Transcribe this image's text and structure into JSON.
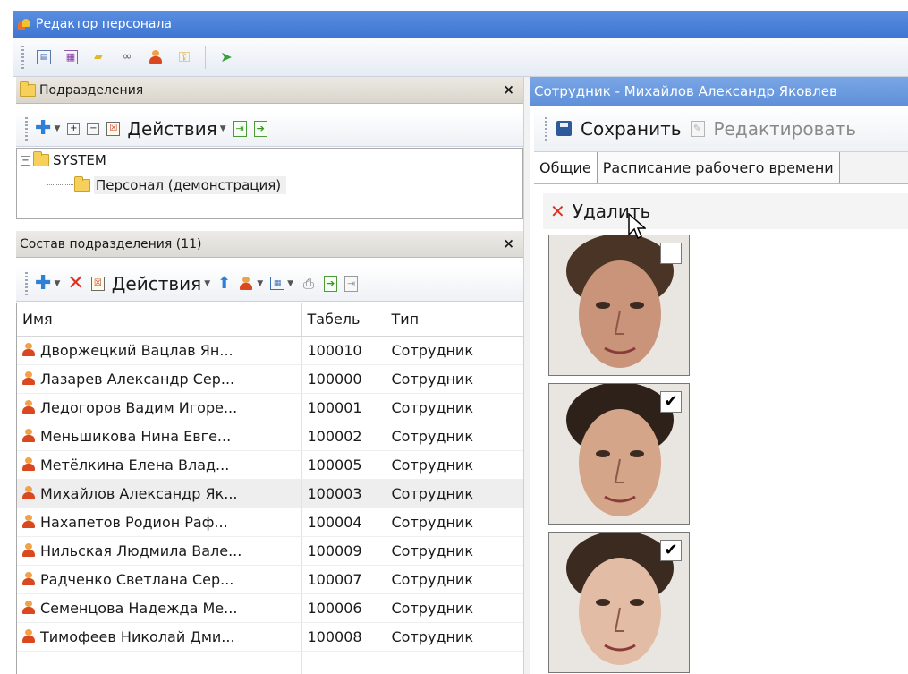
{
  "window": {
    "title": "Редактор персонала"
  },
  "main_toolbar": {
    "icons": [
      "tree-view-icon",
      "grid-view-icon",
      "notes-icon",
      "link-icon",
      "person-icon",
      "key-icon",
      "exit-icon"
    ]
  },
  "departments_panel": {
    "title": "Подразделения",
    "close": "×",
    "toolbar": {
      "actions_label": "Действия"
    },
    "tree": {
      "root": "SYSTEM",
      "child": "Персонал (демонстрация)"
    }
  },
  "members_panel": {
    "title": "Состав подразделения (11)",
    "close": "×",
    "toolbar": {
      "actions_label": "Действия"
    },
    "columns": [
      "Имя",
      "Табель",
      "Тип"
    ],
    "rows": [
      {
        "name": "Дворжецкий Вацлав Ян...",
        "tab": "100010",
        "type": "Сотрудник"
      },
      {
        "name": "Лазарев Александр Сер...",
        "tab": "100000",
        "type": "Сотрудник"
      },
      {
        "name": "Ледогоров Вадим Игоре...",
        "tab": "100001",
        "type": "Сотрудник"
      },
      {
        "name": "Меньшикова Нина Евге...",
        "tab": "100002",
        "type": "Сотрудник"
      },
      {
        "name": "Метёлкина Елена Влад...",
        "tab": "100005",
        "type": "Сотрудник"
      },
      {
        "name": "Михайлов Александр Як...",
        "tab": "100003",
        "type": "Сотрудник"
      },
      {
        "name": "Нахапетов Родион Раф...",
        "tab": "100004",
        "type": "Сотрудник"
      },
      {
        "name": "Нильская Людмила Вале...",
        "tab": "100009",
        "type": "Сотрудник"
      },
      {
        "name": "Радченко Светлана Сер...",
        "tab": "100007",
        "type": "Сотрудник"
      },
      {
        "name": "Семенцова Надежда Ме...",
        "tab": "100006",
        "type": "Сотрудник"
      },
      {
        "name": "Тимофеев Николай Дми...",
        "tab": "100008",
        "type": "Сотрудник"
      }
    ],
    "selected_index": 5
  },
  "employee_panel": {
    "title": "Сотрудник - Михайлов Александр Яковлев",
    "save_label": "Сохранить",
    "edit_label": "Редактировать",
    "tabs": [
      "Общие",
      "Расписание рабочего времени"
    ],
    "delete_label": "Удалить",
    "photos": [
      {
        "checked": false,
        "skin": "#c99479",
        "hair": "#4a3425"
      },
      {
        "checked": true,
        "skin": "#d5a58a",
        "hair": "#2e211a"
      },
      {
        "checked": true,
        "skin": "#e3bca6",
        "hair": "#3b2a1f"
      }
    ]
  },
  "colors": {
    "title_bar": "#4a7fd8",
    "selected_row": "#eeeeee",
    "delete_x": "#e0301e"
  }
}
